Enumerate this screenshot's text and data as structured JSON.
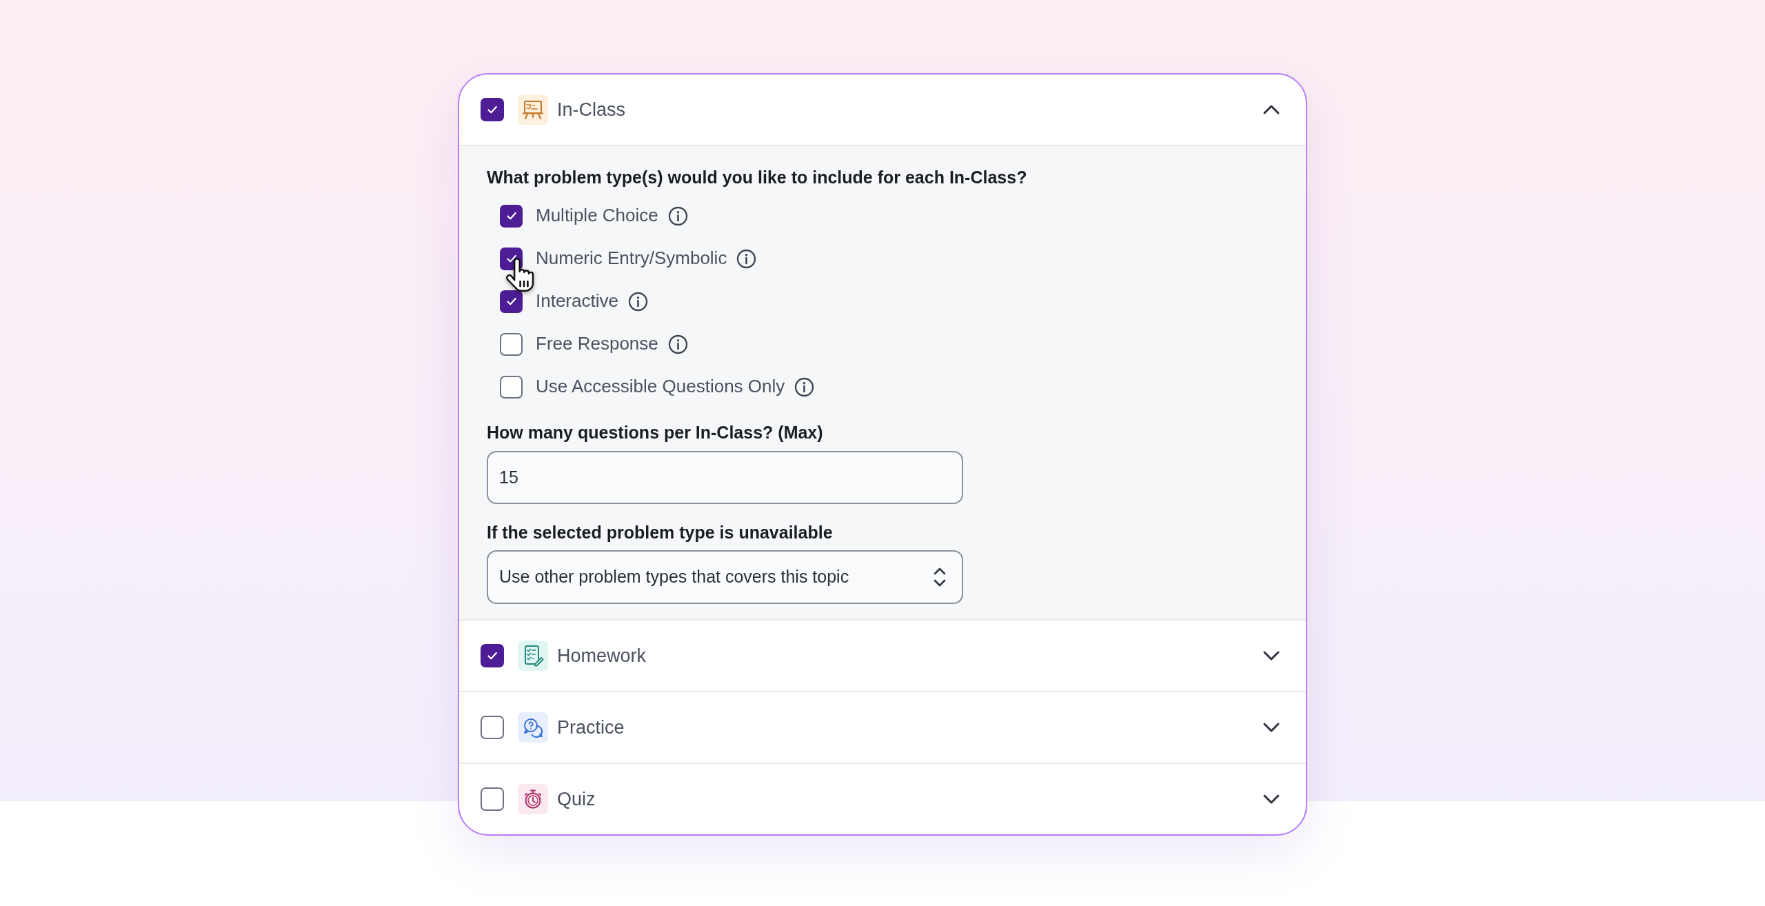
{
  "sections": [
    {
      "kind": "board",
      "label": "In-Class",
      "checked": true,
      "expanded": true,
      "body": {
        "question": "What problem type(s) would you like to include for each In-Class?",
        "options": [
          {
            "label": "Multiple Choice",
            "checked": true
          },
          {
            "label": "Numeric Entry/Symbolic",
            "checked": true
          },
          {
            "label": "Interactive",
            "checked": true
          },
          {
            "label": "Free Response",
            "checked": false
          },
          {
            "label": "Use Accessible Questions Only",
            "checked": false
          }
        ],
        "count_field": {
          "label": "How many questions per In-Class? (Max)",
          "value": "15"
        },
        "fallback_field": {
          "label": "If the selected problem type is unavailable",
          "value": "Use other problem types that covers this topic"
        }
      }
    },
    {
      "kind": "checklist",
      "label": "Homework",
      "checked": true,
      "expanded": false
    },
    {
      "kind": "chat",
      "label": "Practice",
      "checked": false,
      "expanded": false
    },
    {
      "kind": "stopwatch",
      "label": "Quiz",
      "checked": false,
      "expanded": false
    }
  ]
}
